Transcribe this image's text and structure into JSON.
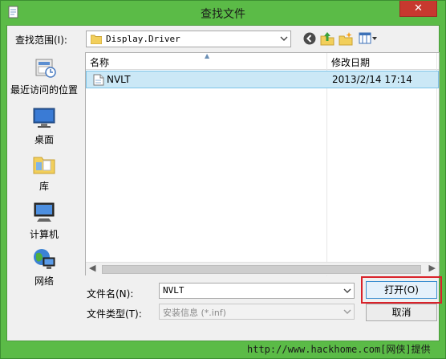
{
  "window": {
    "title": "查找文件",
    "close_label": "✕"
  },
  "lookin": {
    "label": "查找范围(I):",
    "value": "Display.Driver"
  },
  "toolbar": {
    "icons": [
      "back-icon",
      "up-folder-icon",
      "new-folder-icon",
      "view-menu-icon"
    ]
  },
  "places": [
    {
      "label": "最近访问的位置",
      "icon": "recent-places-icon"
    },
    {
      "label": "桌面",
      "icon": "desktop-icon"
    },
    {
      "label": "库",
      "icon": "libraries-icon"
    },
    {
      "label": "计算机",
      "icon": "computer-icon"
    },
    {
      "label": "网络",
      "icon": "network-icon"
    }
  ],
  "filelist": {
    "columns": [
      "名称",
      "修改日期"
    ],
    "rows": [
      {
        "name": "NVLT",
        "date": "2013/2/14 17:14"
      }
    ]
  },
  "filename": {
    "label": "文件名(N):",
    "value": "NVLT"
  },
  "filetype": {
    "label": "文件类型(T):",
    "value": "安装信息 (*.inf)"
  },
  "buttons": {
    "open": "打开(O)",
    "cancel": "取消"
  },
  "watermark": "http://www.hackhome.com[网侠]提供",
  "colors": {
    "frame": "#5bbb47",
    "close": "#c7392f",
    "selection": "#cbe8f6",
    "highlight": "#d9222a"
  }
}
